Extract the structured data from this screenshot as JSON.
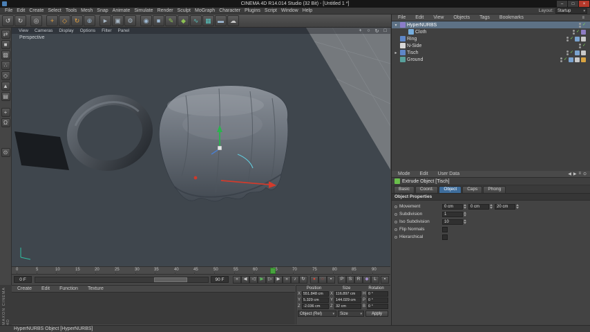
{
  "window": {
    "title": "CINEMA 4D R14.014 Studio (32 Bit) - [Untitled 1 *]",
    "minimize": "–",
    "maximize": "□",
    "close": "×"
  },
  "menubar": {
    "items": [
      "File",
      "Edit",
      "Create",
      "Select",
      "Tools",
      "Mesh",
      "Snap",
      "Animate",
      "Simulate",
      "Render",
      "Sculpt",
      "MoGraph",
      "Character",
      "Plugins",
      "Script",
      "Window",
      "Help"
    ],
    "layout_label": "Layout:",
    "layout_value": "Startup"
  },
  "icons": {
    "undo": "↺",
    "redo": "↻",
    "live_selection": "◎",
    "move": "+",
    "scale": "◇",
    "rotate": "↻",
    "coord_system": "⊕",
    "render_view": "►",
    "render_pv": "▣",
    "render_settings": "⚙",
    "hypernurbs": "◉",
    "cube": "■",
    "spline": "✎",
    "mograph": "◆",
    "simulate": "∿",
    "cloth_sim": "▦",
    "floor": "▬",
    "sky": "☁",
    "make_editable": "⇄",
    "model_mode": "■",
    "texture_mode": "▨",
    "points_mode": "∴",
    "edges_mode": "◇",
    "polygons_mode": "▲",
    "workplane": "▤",
    "enable_axis": "+",
    "snap": "Ω",
    "lock_axis": "⊙",
    "vp_pan": "+",
    "vp_zoom": "○",
    "vp_rotate": "↻",
    "vp_maximize": "□",
    "goto_start": "«",
    "prev_key": "◀",
    "prev_frame": "◁",
    "play": "▶",
    "next_frame": "▷",
    "next_key": "▶",
    "goto_end": "»",
    "sound": "♪",
    "loop": "↻",
    "record": "●",
    "autokey": "○",
    "key_selection": "▪",
    "toggle_pos": "P",
    "toggle_scale": "S",
    "toggle_rot": "R",
    "toggle_param": "◆",
    "toggle_pla": "L",
    "om_burger": "≡",
    "am_prev": "◀",
    "am_next": "▶",
    "am_history": "≡",
    "am_lock": "⊙",
    "expander_open": "▾",
    "expander_closed": "▸",
    "check": "✓",
    "dropdown": "▾"
  },
  "viewport": {
    "menus": [
      "View",
      "Cameras",
      "Display",
      "Options",
      "Filter",
      "Panel"
    ],
    "label": "Perspective"
  },
  "timeline": {
    "ticks": [
      "0",
      "5",
      "10",
      "15",
      "20",
      "25",
      "30",
      "35",
      "40",
      "45",
      "50",
      "55",
      "60",
      "65",
      "70",
      "75",
      "80",
      "85",
      "90"
    ],
    "current_frame": "65",
    "range_start": "0 F",
    "range_end": "90 F"
  },
  "material_manager": {
    "menus": [
      "Create",
      "Edit",
      "Function",
      "Texture"
    ]
  },
  "coordinates": {
    "headers": [
      "Position",
      "Size",
      "Rotation"
    ],
    "position": {
      "x_label": "X",
      "x": "551.848 cm",
      "y_label": "Y",
      "y": "5.329 cm",
      "z_label": "Z",
      "z": "-2.036 cm"
    },
    "size": {
      "x_label": "X",
      "x": "116.897 cm",
      "y_label": "Y",
      "y": "144.029 cm",
      "z_label": "Z",
      "z": "32 cm"
    },
    "rotation": {
      "h_label": "H",
      "h": "0 °",
      "p_label": "P",
      "p": "0 °",
      "b_label": "B",
      "b": "0 °"
    },
    "mode_dropdown": "Object (Rel)",
    "size_dropdown": "Size",
    "apply": "Apply"
  },
  "object_manager": {
    "menus": [
      "File",
      "Edit",
      "View",
      "Objects",
      "Tags",
      "Bookmarks"
    ],
    "objects": [
      {
        "name": "HyperNURBS",
        "selected": true
      },
      {
        "name": "Cloth",
        "selected": false
      },
      {
        "name": "Ring",
        "selected": false
      },
      {
        "name": "N-Side",
        "selected": false
      },
      {
        "name": "Tisch",
        "selected": false
      },
      {
        "name": "Ground",
        "selected": false
      }
    ]
  },
  "attribute_manager": {
    "menus": [
      "Mode",
      "Edit",
      "User Data"
    ],
    "title": "Extrude Object [Tisch]",
    "tabs": [
      "Basic",
      "Coord.",
      "Object",
      "Caps",
      "Phong"
    ],
    "active_tab": "Object",
    "section": "Object Properties",
    "props": {
      "movement_label": "Movement",
      "movement_x": "0 cm",
      "movement_y": "0 cm",
      "movement_z": "20 cm",
      "subdivision_label": "Subdivision",
      "subdivision": "1",
      "iso_label": "Iso Subdivision",
      "iso": "10",
      "flip_label": "Flip Normals",
      "hier_label": "Hierarchical"
    }
  },
  "statusbar": {
    "text": "HyperNURBS Object [HyperNURBS]"
  },
  "branding": {
    "text": "MAXON CINEMA 4D"
  },
  "colors": {
    "selected_row": "#5d7185",
    "active_tab": "#3e6d9c",
    "play_green": "#5cb85c",
    "record_red": "#c74a3a",
    "viewport_bg": "#3f464d",
    "ground_plane": "#75797d",
    "axis_green": "#2ab34d",
    "axis_red": "#d23b2c"
  }
}
